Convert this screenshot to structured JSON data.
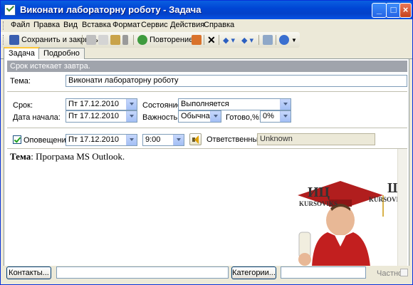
{
  "window": {
    "title": "Виконати лабораторну роботу - Задача"
  },
  "menu": [
    "Файл",
    "Правка",
    "Вид",
    "Вставка",
    "Формат",
    "Сервис",
    "Действия",
    "Справка"
  ],
  "toolbar": {
    "save_close": "Сохранить и закрыть",
    "recurrence": "Повторение..."
  },
  "tabs": [
    "Задача",
    "Подробно"
  ],
  "infobar": "Срок истекает завтра.",
  "form": {
    "subject_label": "Тема:",
    "subject_value": "Виконати лабораторну роботу",
    "due_label": "Срок:",
    "due_value": "Пт 17.12.2010",
    "start_label": "Дата начала:",
    "start_value": "Пт 17.12.2010",
    "status_label": "Состояние:",
    "status_value": "Выполняется",
    "priority_label": "Важность:",
    "priority_value": "Обычная",
    "percent_label": "Готово,%:",
    "percent_value": "0%",
    "reminder_label": "Оповещение:",
    "reminder_date": "Пт 17.12.2010",
    "reminder_time": "9:00",
    "owner_label": "Ответственный:",
    "owner_value": "Unknown"
  },
  "body": {
    "label": "Тема",
    "text": ": Програма MS Outlook."
  },
  "watermark": {
    "left_big": "ИЦ",
    "left_small": "KURSOVIKS",
    "right_big": "Щ",
    "right_small": "KURSOVIKS"
  },
  "footer": {
    "contacts": "Контакты...",
    "categories": "Категории...",
    "private": "Частное"
  },
  "colors": {
    "titlebar": "#0A5FE0",
    "infobar": "#A0A4AC",
    "window_bg": "#ECE9D8"
  }
}
